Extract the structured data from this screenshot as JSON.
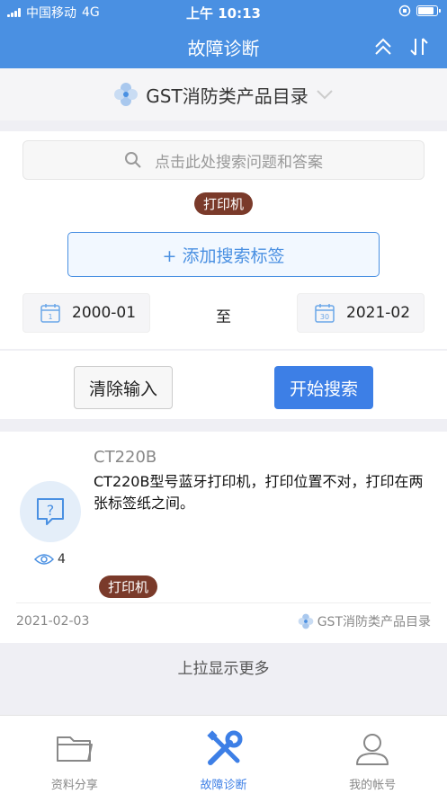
{
  "status_bar": {
    "carrier": "中国移动",
    "network": "4G",
    "time": "上午 10:13"
  },
  "nav": {
    "title": "故障诊断",
    "collapse_icon": "double-chevron-up-icon",
    "sort_icon": "sort-arrows-icon"
  },
  "catalog": {
    "title": "GST消防类产品目录",
    "icon": "gst-logo-icon"
  },
  "search": {
    "placeholder": "点击此处搜索问题和答案",
    "tags": [
      "打印机"
    ],
    "add_tag_label": "+ 添加搜索标签",
    "date_from": "2000-01",
    "date_from_day": "1",
    "date_to": "2021-02",
    "date_to_day": "30",
    "date_separator": "至",
    "clear_label": "清除输入",
    "start_label": "开始搜索"
  },
  "results": [
    {
      "code": "CT220B",
      "description": "CT220B型号蓝牙打印机，打印位置不对，打印在两张标签纸之间。",
      "avatar_glyph": "?",
      "views": "4",
      "tag": "打印机",
      "date": "2021-02-03",
      "source": "GST消防类产品目录"
    }
  ],
  "load_more_label": "上拉显示更多",
  "tabs": [
    {
      "label": "资料分享",
      "icon": "folder-icon",
      "active": false
    },
    {
      "label": "故障诊断",
      "icon": "tools-icon",
      "active": true
    },
    {
      "label": "我的帐号",
      "icon": "user-icon",
      "active": false
    }
  ],
  "colors": {
    "primary": "#4a90e2",
    "button_blue": "#3d7fe6",
    "tag_brown": "#7a3a2a",
    "background": "#efeff4"
  },
  "battery_level": 0.9
}
